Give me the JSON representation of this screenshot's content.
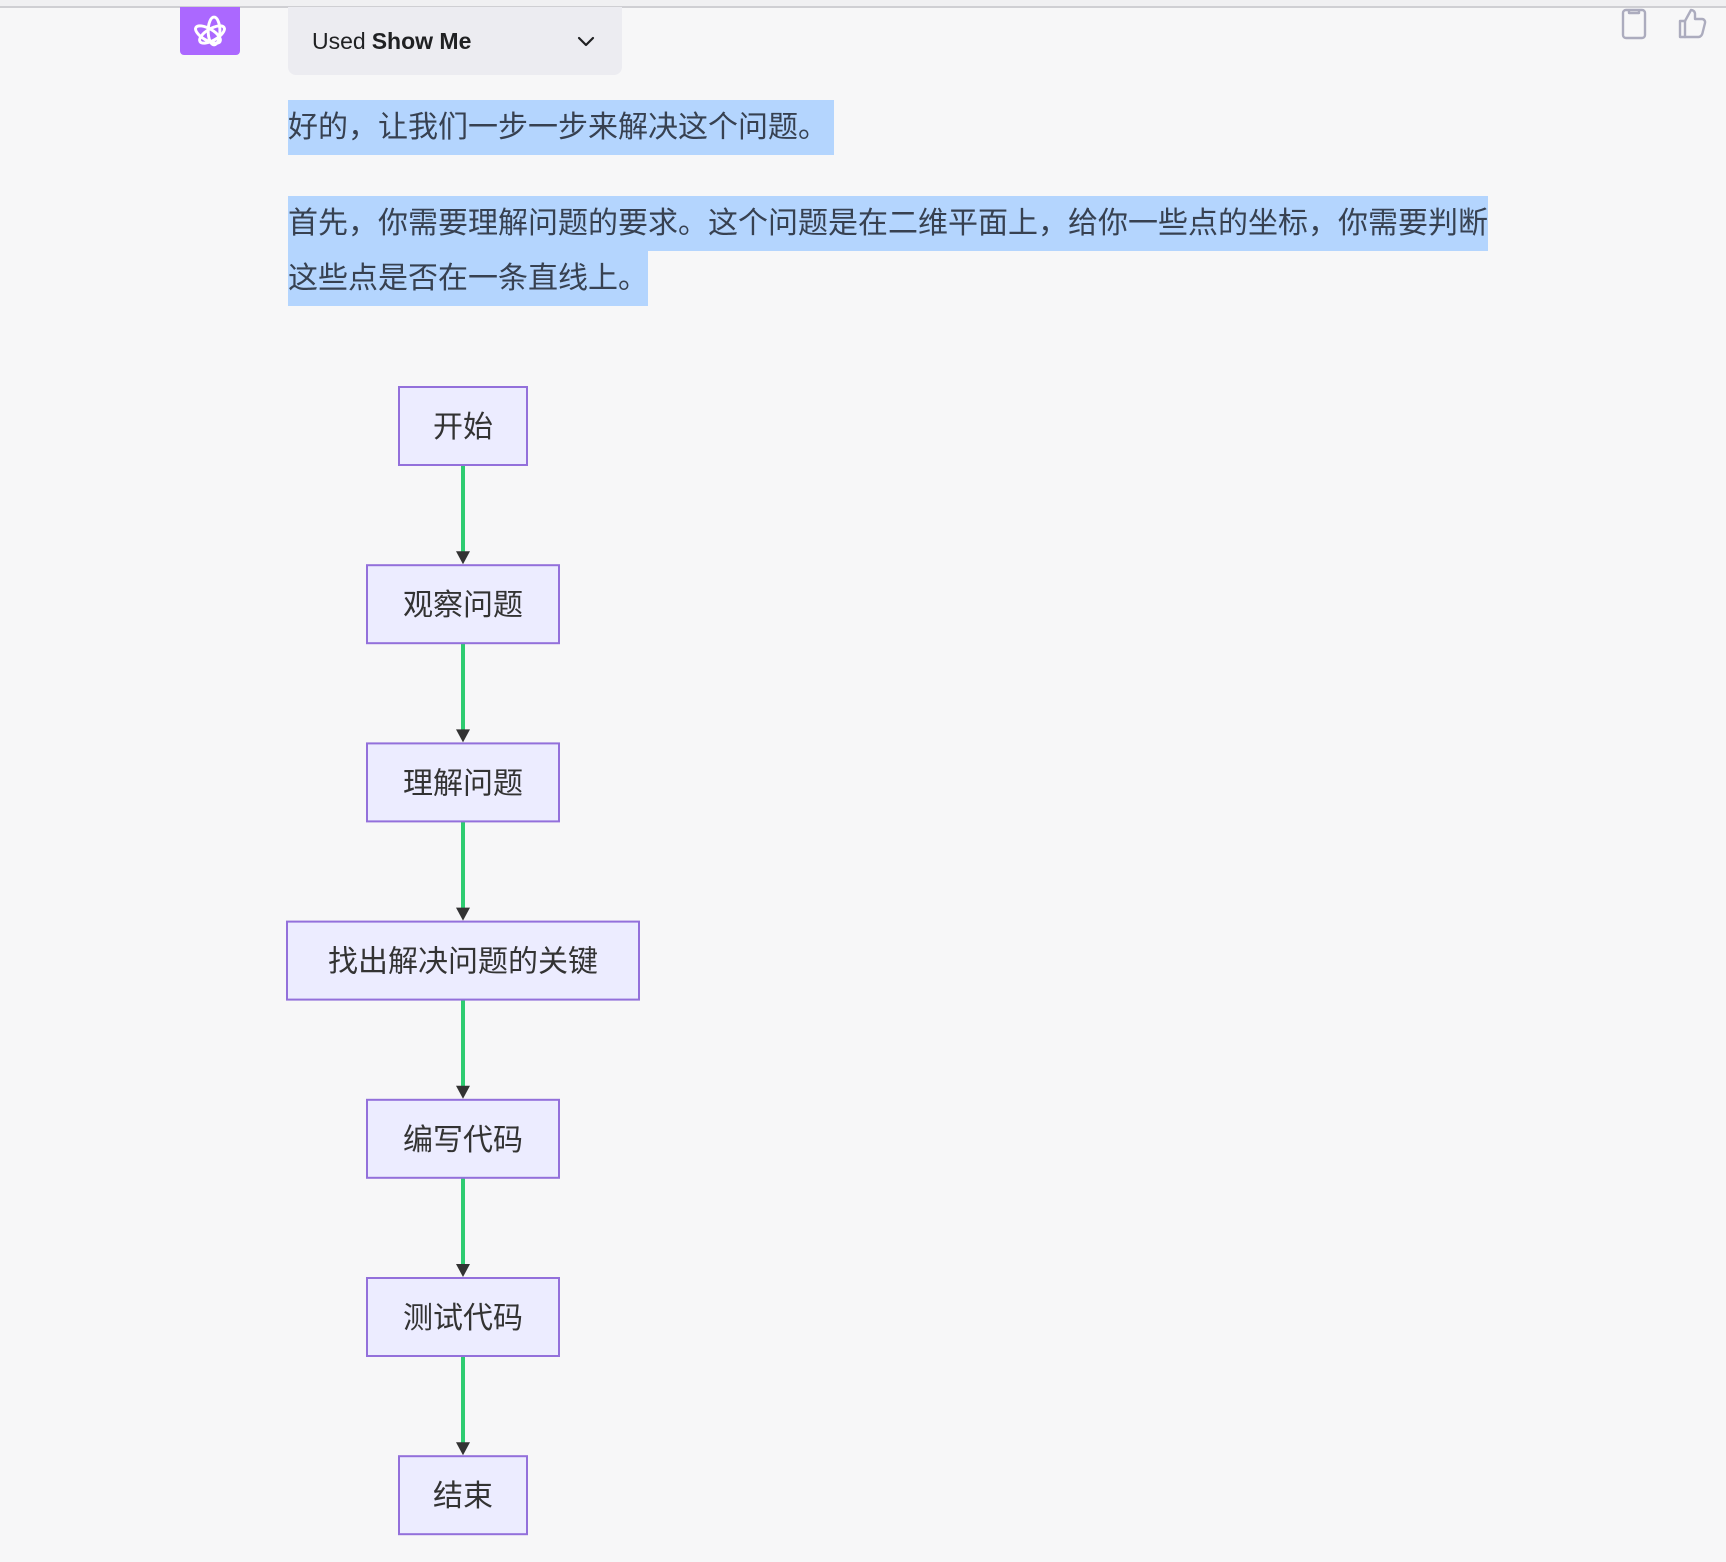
{
  "assistant": {
    "avatar_icon": "openai-logo-icon",
    "avatar_color": "#ab68ff"
  },
  "tool_use": {
    "prefix": "Used",
    "plugin_name": "Show Me",
    "expand_icon": "chevron-down-icon"
  },
  "message_actions": [
    {
      "name": "copy",
      "icon": "clipboard-icon"
    },
    {
      "name": "thumbs-up",
      "icon": "thumbs-up-icon"
    }
  ],
  "message": {
    "paragraph_1": "好的，让我们一步一步来解决这个问题。",
    "paragraph_2_line_1": "首先，你需要理解问题的要求。这个问题是在二维平面上，给你一些点的坐标，你需要判断",
    "paragraph_2_line_2": "这些点是否在一条直线上。"
  },
  "flowchart": {
    "node_fill": "#ececff",
    "node_stroke": "#9370db",
    "edge_color": "#2ecc71",
    "arrow_color": "#333333",
    "nodes": [
      {
        "id": "start",
        "label": "开始"
      },
      {
        "id": "observe",
        "label": "观察问题"
      },
      {
        "id": "understand",
        "label": "理解问题"
      },
      {
        "id": "find_key",
        "label": "找出解决问题的关键"
      },
      {
        "id": "write_code",
        "label": "编写代码"
      },
      {
        "id": "test_code",
        "label": "测试代码"
      },
      {
        "id": "end",
        "label": "结束"
      }
    ],
    "edges": [
      {
        "from": "start",
        "to": "observe"
      },
      {
        "from": "observe",
        "to": "understand"
      },
      {
        "from": "understand",
        "to": "find_key"
      },
      {
        "from": "find_key",
        "to": "write_code"
      },
      {
        "from": "write_code",
        "to": "test_code"
      },
      {
        "from": "test_code",
        "to": "end"
      }
    ]
  }
}
